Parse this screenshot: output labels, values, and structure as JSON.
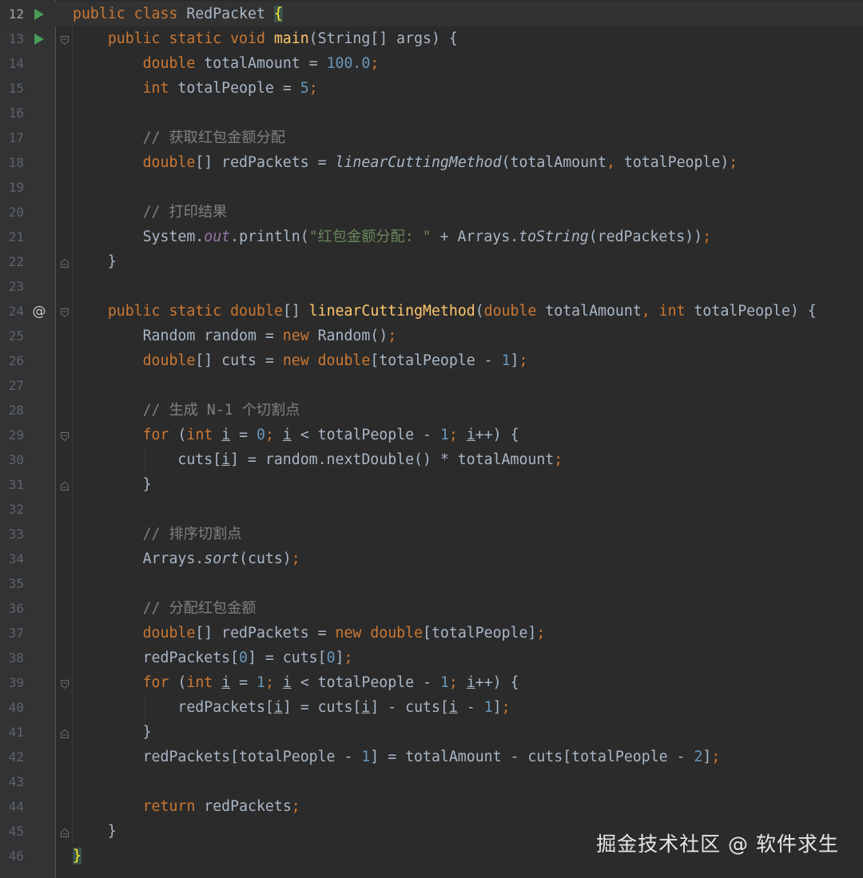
{
  "editor": {
    "lines": [
      {
        "n": "12",
        "marker": "run",
        "fold": "",
        "tokens": [
          {
            "t": "public class ",
            "c": "kw"
          },
          {
            "t": "RedPacket ",
            "c": ""
          },
          {
            "t": "{",
            "c": "brace"
          }
        ]
      },
      {
        "n": "13",
        "marker": "run",
        "fold": "open",
        "tokens": [
          {
            "t": "    "
          },
          {
            "t": "public static void ",
            "c": "kw"
          },
          {
            "t": "main",
            "c": "fn"
          },
          {
            "t": "(String[] args) {"
          }
        ]
      },
      {
        "n": "14",
        "marker": "",
        "fold": "",
        "tokens": [
          {
            "t": "        "
          },
          {
            "t": "double ",
            "c": "kw"
          },
          {
            "t": "totalAmount = "
          },
          {
            "t": "100.0",
            "c": "num"
          },
          {
            "t": ";",
            "c": "kw"
          }
        ]
      },
      {
        "n": "15",
        "marker": "",
        "fold": "",
        "tokens": [
          {
            "t": "        "
          },
          {
            "t": "int ",
            "c": "kw"
          },
          {
            "t": "totalPeople = "
          },
          {
            "t": "5",
            "c": "num"
          },
          {
            "t": ";",
            "c": "kw"
          }
        ]
      },
      {
        "n": "16",
        "marker": "",
        "fold": "",
        "tokens": []
      },
      {
        "n": "17",
        "marker": "",
        "fold": "",
        "tokens": [
          {
            "t": "        "
          },
          {
            "t": "// 获取红包金额分配",
            "c": "com"
          }
        ]
      },
      {
        "n": "18",
        "marker": "",
        "fold": "",
        "tokens": [
          {
            "t": "        "
          },
          {
            "t": "double",
            "c": "kw"
          },
          {
            "t": "[] redPackets = "
          },
          {
            "t": "linearCuttingMethod",
            "c": "it"
          },
          {
            "t": "(totalAmount"
          },
          {
            "t": ", ",
            "c": "kw"
          },
          {
            "t": "totalPeople)"
          },
          {
            "t": ";",
            "c": "kw"
          }
        ]
      },
      {
        "n": "19",
        "marker": "",
        "fold": "",
        "tokens": []
      },
      {
        "n": "20",
        "marker": "",
        "fold": "",
        "tokens": [
          {
            "t": "        "
          },
          {
            "t": "// 打印结果",
            "c": "com"
          }
        ]
      },
      {
        "n": "21",
        "marker": "",
        "fold": "",
        "tokens": [
          {
            "t": "        "
          },
          {
            "t": "System."
          },
          {
            "t": "out",
            "c": "field"
          },
          {
            "t": ".println("
          },
          {
            "t": "\"红包金额分配: \"",
            "c": "str"
          },
          {
            "t": " + Arrays."
          },
          {
            "t": "toString",
            "c": "it"
          },
          {
            "t": "(redPackets))"
          },
          {
            "t": ";",
            "c": "kw"
          }
        ]
      },
      {
        "n": "22",
        "marker": "",
        "fold": "close",
        "tokens": [
          {
            "t": "    }"
          }
        ]
      },
      {
        "n": "23",
        "marker": "",
        "fold": "",
        "tokens": []
      },
      {
        "n": "24",
        "marker": "at",
        "fold": "open",
        "tokens": [
          {
            "t": "    "
          },
          {
            "t": "public static double",
            "c": "kw"
          },
          {
            "t": "[] "
          },
          {
            "t": "linearCuttingMethod",
            "c": "fn"
          },
          {
            "t": "("
          },
          {
            "t": "double ",
            "c": "kw"
          },
          {
            "t": "totalAmount"
          },
          {
            "t": ", int ",
            "c": "kw"
          },
          {
            "t": "totalPeople) {"
          }
        ]
      },
      {
        "n": "25",
        "marker": "",
        "fold": "",
        "tokens": [
          {
            "t": "        Random random = "
          },
          {
            "t": "new ",
            "c": "kw"
          },
          {
            "t": "Random()"
          },
          {
            "t": ";",
            "c": "kw"
          }
        ]
      },
      {
        "n": "26",
        "marker": "",
        "fold": "",
        "tokens": [
          {
            "t": "        "
          },
          {
            "t": "double",
            "c": "kw"
          },
          {
            "t": "[] cuts = "
          },
          {
            "t": "new double",
            "c": "kw"
          },
          {
            "t": "[totalPeople - "
          },
          {
            "t": "1",
            "c": "num"
          },
          {
            "t": "]"
          },
          {
            "t": ";",
            "c": "kw"
          }
        ]
      },
      {
        "n": "27",
        "marker": "",
        "fold": "",
        "tokens": []
      },
      {
        "n": "28",
        "marker": "",
        "fold": "",
        "tokens": [
          {
            "t": "        "
          },
          {
            "t": "// 生成 N-1 个切割点",
            "c": "com"
          }
        ]
      },
      {
        "n": "29",
        "marker": "",
        "fold": "open",
        "tokens": [
          {
            "t": "        "
          },
          {
            "t": "for ",
            "c": "kw"
          },
          {
            "t": "("
          },
          {
            "t": "int ",
            "c": "kw"
          },
          {
            "t": "i",
            "c": "u"
          },
          {
            "t": " = "
          },
          {
            "t": "0",
            "c": "num"
          },
          {
            "t": "; ",
            "c": "kw"
          },
          {
            "t": "i",
            "c": "u"
          },
          {
            "t": " < totalPeople - "
          },
          {
            "t": "1",
            "c": "num"
          },
          {
            "t": "; ",
            "c": "kw"
          },
          {
            "t": "i",
            "c": "u"
          },
          {
            "t": "++) {"
          }
        ]
      },
      {
        "n": "30",
        "marker": "",
        "fold": "",
        "tokens": [
          {
            "t": "            cuts["
          },
          {
            "t": "i",
            "c": "u"
          },
          {
            "t": "] = random.nextDouble() * totalAmount"
          },
          {
            "t": ";",
            "c": "kw"
          }
        ]
      },
      {
        "n": "31",
        "marker": "",
        "fold": "close",
        "tokens": [
          {
            "t": "        }"
          }
        ]
      },
      {
        "n": "32",
        "marker": "",
        "fold": "",
        "tokens": []
      },
      {
        "n": "33",
        "marker": "",
        "fold": "",
        "tokens": [
          {
            "t": "        "
          },
          {
            "t": "// 排序切割点",
            "c": "com"
          }
        ]
      },
      {
        "n": "34",
        "marker": "",
        "fold": "",
        "tokens": [
          {
            "t": "        Arrays."
          },
          {
            "t": "sort",
            "c": "it"
          },
          {
            "t": "(cuts)"
          },
          {
            "t": ";",
            "c": "kw"
          }
        ]
      },
      {
        "n": "35",
        "marker": "",
        "fold": "",
        "tokens": []
      },
      {
        "n": "36",
        "marker": "",
        "fold": "",
        "tokens": [
          {
            "t": "        "
          },
          {
            "t": "// 分配红包金额",
            "c": "com"
          }
        ]
      },
      {
        "n": "37",
        "marker": "",
        "fold": "",
        "tokens": [
          {
            "t": "        "
          },
          {
            "t": "double",
            "c": "kw"
          },
          {
            "t": "[] redPackets = "
          },
          {
            "t": "new double",
            "c": "kw"
          },
          {
            "t": "[totalPeople]"
          },
          {
            "t": ";",
            "c": "kw"
          }
        ]
      },
      {
        "n": "38",
        "marker": "",
        "fold": "",
        "tokens": [
          {
            "t": "        redPackets["
          },
          {
            "t": "0",
            "c": "num"
          },
          {
            "t": "] = cuts["
          },
          {
            "t": "0",
            "c": "num"
          },
          {
            "t": "]"
          },
          {
            "t": ";",
            "c": "kw"
          }
        ]
      },
      {
        "n": "39",
        "marker": "",
        "fold": "open",
        "tokens": [
          {
            "t": "        "
          },
          {
            "t": "for ",
            "c": "kw"
          },
          {
            "t": "("
          },
          {
            "t": "int ",
            "c": "kw"
          },
          {
            "t": "i",
            "c": "u"
          },
          {
            "t": " = "
          },
          {
            "t": "1",
            "c": "num"
          },
          {
            "t": "; ",
            "c": "kw"
          },
          {
            "t": "i",
            "c": "u"
          },
          {
            "t": " < totalPeople - "
          },
          {
            "t": "1",
            "c": "num"
          },
          {
            "t": "; ",
            "c": "kw"
          },
          {
            "t": "i",
            "c": "u"
          },
          {
            "t": "++) {"
          }
        ]
      },
      {
        "n": "40",
        "marker": "",
        "fold": "",
        "tokens": [
          {
            "t": "            redPackets["
          },
          {
            "t": "i",
            "c": "u"
          },
          {
            "t": "] = cuts["
          },
          {
            "t": "i",
            "c": "u"
          },
          {
            "t": "] - cuts["
          },
          {
            "t": "i",
            "c": "u"
          },
          {
            "t": " - "
          },
          {
            "t": "1",
            "c": "num"
          },
          {
            "t": "]"
          },
          {
            "t": ";",
            "c": "kw"
          }
        ]
      },
      {
        "n": "41",
        "marker": "",
        "fold": "close",
        "tokens": [
          {
            "t": "        }"
          }
        ]
      },
      {
        "n": "42",
        "marker": "",
        "fold": "",
        "tokens": [
          {
            "t": "        redPackets[totalPeople - "
          },
          {
            "t": "1",
            "c": "num"
          },
          {
            "t": "] = totalAmount - cuts[totalPeople - "
          },
          {
            "t": "2",
            "c": "num"
          },
          {
            "t": "]"
          },
          {
            "t": ";",
            "c": "kw"
          }
        ]
      },
      {
        "n": "43",
        "marker": "",
        "fold": "",
        "tokens": []
      },
      {
        "n": "44",
        "marker": "",
        "fold": "",
        "tokens": [
          {
            "t": "        "
          },
          {
            "t": "return ",
            "c": "kw"
          },
          {
            "t": "redPackets"
          },
          {
            "t": ";",
            "c": "kw"
          }
        ]
      },
      {
        "n": "45",
        "marker": "",
        "fold": "close",
        "tokens": [
          {
            "t": "    }"
          }
        ]
      },
      {
        "n": "46",
        "marker": "",
        "fold": "",
        "tokens": [
          {
            "t": "}",
            "c": "brace"
          }
        ]
      }
    ]
  },
  "watermark": {
    "text": "掘金技术社区 @ 软件求生"
  }
}
